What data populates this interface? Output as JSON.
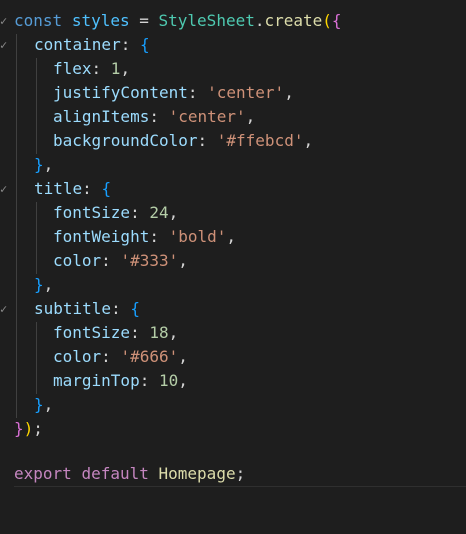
{
  "editor": {
    "language": "javascript",
    "fold_marker_icon": "fold-chevron-icon",
    "lines": {
      "l1": {
        "t1": "const",
        "t2": " ",
        "t3": "styles",
        "t4": " = ",
        "t5": "StyleSheet",
        "t6": ".",
        "t7": "create",
        "t8": "(",
        "t9": "{"
      },
      "l2": {
        "t1": "container",
        "t2": ": ",
        "t3": "{"
      },
      "l3": {
        "t1": "flex",
        "t2": ": ",
        "t3": "1",
        "t4": ","
      },
      "l4": {
        "t1": "justifyContent",
        "t2": ": ",
        "t3": "'center'",
        "t4": ","
      },
      "l5": {
        "t1": "alignItems",
        "t2": ": ",
        "t3": "'center'",
        "t4": ","
      },
      "l6": {
        "t1": "backgroundColor",
        "t2": ": ",
        "t3": "'#ffebcd'",
        "t4": ","
      },
      "l7": {
        "t1": "}",
        "t2": ","
      },
      "l8": {
        "t1": "title",
        "t2": ": ",
        "t3": "{"
      },
      "l9": {
        "t1": "fontSize",
        "t2": ": ",
        "t3": "24",
        "t4": ","
      },
      "l10": {
        "t1": "fontWeight",
        "t2": ": ",
        "t3": "'bold'",
        "t4": ","
      },
      "l11": {
        "t1": "color",
        "t2": ": ",
        "t3": "'#333'",
        "t4": ","
      },
      "l12": {
        "t1": "}",
        "t2": ","
      },
      "l13": {
        "t1": "subtitle",
        "t2": ": ",
        "t3": "{"
      },
      "l14": {
        "t1": "fontSize",
        "t2": ": ",
        "t3": "18",
        "t4": ","
      },
      "l15": {
        "t1": "color",
        "t2": ": ",
        "t3": "'#666'",
        "t4": ","
      },
      "l16": {
        "t1": "marginTop",
        "t2": ": ",
        "t3": "10",
        "t4": ","
      },
      "l17": {
        "t1": "}",
        "t2": ","
      },
      "l18": {
        "t1": "}",
        "t2": ")",
        "t3": ";"
      },
      "l19": {},
      "l20": {
        "t1": "export",
        "t2": " ",
        "t3": "default",
        "t4": " ",
        "t5": "Homepage",
        "t6": ";"
      }
    },
    "colors": {
      "background": "#1e1e1e",
      "keyword": "#569cd6",
      "control_keyword": "#c586c0",
      "variable": "#4fc1ff",
      "class": "#4ec9b0",
      "function": "#dcdcaa",
      "property": "#9cdcfe",
      "number": "#b5cea8",
      "string": "#ce9178",
      "bracket_level_1": "#ffd700",
      "bracket_level_2": "#da70d6",
      "bracket_level_3": "#179fff"
    }
  }
}
